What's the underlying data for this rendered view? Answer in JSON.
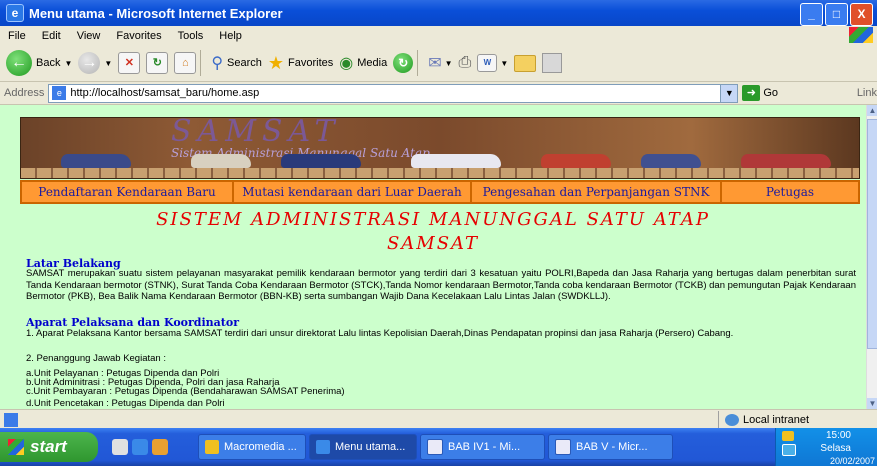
{
  "window": {
    "title": "Menu utama - Microsoft Internet Explorer",
    "controls": [
      "_",
      "□",
      "X"
    ]
  },
  "menubar": [
    "File",
    "Edit",
    "View",
    "Favorites",
    "Tools",
    "Help"
  ],
  "toolbar": {
    "back": "Back",
    "search": "Search",
    "favorites": "Favorites",
    "media": "Media"
  },
  "address": {
    "label": "Address",
    "url": "http://localhost/samsat_baru/home.asp",
    "go": "Go",
    "links": "Link"
  },
  "page": {
    "banner": {
      "title": "SAMSAT",
      "subtitle": "Sistem Administrasi Manunggal Satu Atap"
    },
    "nav": [
      "Pendaftaran Kendaraan Baru",
      "Mutasi kendaraan dari Luar Daerah",
      "Pengesahan dan Perpanjangan STNK",
      "Petugas"
    ],
    "heading_line1": "SISTEM ADMINISTRASI MANUNGGAL SATU ATAP",
    "heading_line2": "SAMSAT",
    "section1_title": "Latar Belakang",
    "section1_text": "SAMSAT merupakan suatu sistem pelayanan masyarakat pemilik kendaraan bermotor yang terdiri dari 3 kesatuan yaitu POLRI,Bapeda dan Jasa Raharja yang bertugas dalam penerbitan surat Tanda Kendaraan bermotor (STNK), Surat Tanda Coba Kendaraan Bermotor (STCK),Tanda Nomor kendaraan Bermotor,Tanda coba kendaraan Bermotor (TCKB) dan pemungutan Pajak Kendaraan Bermotor (PKB), Bea Balik Nama Kendaraan Bermotor (BBN-KB) serta sumbangan Wajib Dana Kecelakaan Lalu Lintas Jalan (SWDKLLJ).",
    "section2_title": "Aparat Pelaksana dan Koordinator",
    "item1": "1. Aparat Pelaksana Kantor bersama SAMSAT terdiri dari unsur direktorat Lalu lintas Kepolisian Daerah,Dinas Pendapatan propinsi dan jasa Raharja (Persero) Cabang.",
    "item2": "2. Penanggung Jawab Kegiatan :",
    "units": [
      "a.Unit Pelayanan : Petugas Dipenda dan Polri",
      "b.Unit Adminitrasi : Petugas Dipenda, Polri dan jasa Raharja",
      "c.Unit Pembayaran : Petugas Dipenda (Bendaharawan SAMSAT Penerima)",
      "d.Unit Pencetakan : Petugas Dipenda dan Polri"
    ]
  },
  "status": {
    "zone": "Local intranet"
  },
  "taskbar": {
    "start": "start",
    "tasks": [
      "Macromedia ...",
      "Menu utama...",
      "BAB IV1 - Mi...",
      "BAB V - Micr..."
    ],
    "time": "15:00",
    "day": "Selasa",
    "date": "20/02/2007"
  }
}
